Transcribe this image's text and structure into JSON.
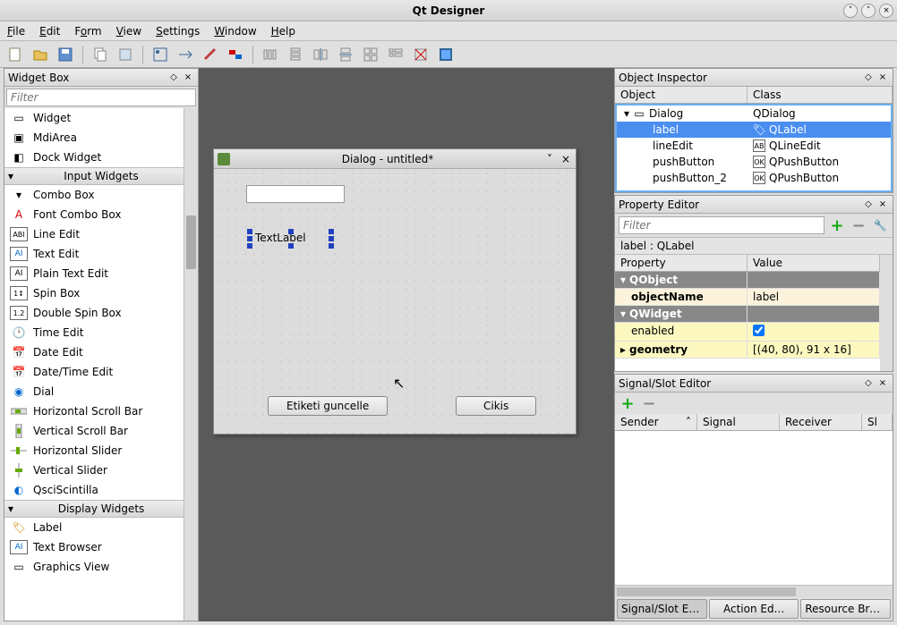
{
  "window": {
    "title": "Qt Designer"
  },
  "menu": {
    "file": "File",
    "edit": "Edit",
    "form": "Form",
    "view": "View",
    "settings": "Settings",
    "window": "Window",
    "help": "Help"
  },
  "widgetbox": {
    "title": "Widget Box",
    "filter_placeholder": "Filter",
    "items": [
      {
        "label": "Widget"
      },
      {
        "label": "MdiArea"
      },
      {
        "label": "Dock Widget"
      }
    ],
    "cat_input": "Input Widgets",
    "input_widgets": [
      {
        "label": "Combo Box"
      },
      {
        "label": "Font Combo Box"
      },
      {
        "label": "Line Edit"
      },
      {
        "label": "Text Edit"
      },
      {
        "label": "Plain Text Edit"
      },
      {
        "label": "Spin Box"
      },
      {
        "label": "Double Spin Box"
      },
      {
        "label": "Time Edit"
      },
      {
        "label": "Date Edit"
      },
      {
        "label": "Date/Time Edit"
      },
      {
        "label": "Dial"
      },
      {
        "label": "Horizontal Scroll Bar"
      },
      {
        "label": "Vertical Scroll Bar"
      },
      {
        "label": "Horizontal Slider"
      },
      {
        "label": "Vertical Slider"
      },
      {
        "label": "QsciScintilla"
      }
    ],
    "cat_display": "Display Widgets",
    "display_widgets": [
      {
        "label": "Label"
      },
      {
        "label": "Text Browser"
      },
      {
        "label": "Graphics View"
      }
    ]
  },
  "dialog": {
    "title": "Dialog - untitled*",
    "label_text": "TextLabel",
    "btn1": "Etiketi guncelle",
    "btn2": "Cikis"
  },
  "object_inspector": {
    "title": "Object Inspector",
    "col_object": "Object",
    "col_class": "Class",
    "rows": [
      {
        "object": "Dialog",
        "class": "QDialog",
        "indent": 0
      },
      {
        "object": "label",
        "class": "QLabel",
        "indent": 1,
        "selected": true
      },
      {
        "object": "lineEdit",
        "class": "QLineEdit",
        "indent": 1
      },
      {
        "object": "pushButton",
        "class": "QPushButton",
        "indent": 1
      },
      {
        "object": "pushButton_2",
        "class": "QPushButton",
        "indent": 1
      }
    ]
  },
  "property_editor": {
    "title": "Property Editor",
    "filter_placeholder": "Filter",
    "object_label": "label : QLabel",
    "col_property": "Property",
    "col_value": "Value",
    "group_qobject": "QObject",
    "prop_objectname": "objectName",
    "val_objectname": "label",
    "group_qwidget": "QWidget",
    "prop_enabled": "enabled",
    "prop_geometry": "geometry",
    "val_geometry": "[(40, 80), 91 x 16]"
  },
  "signal_editor": {
    "title": "Signal/Slot Editor",
    "col_sender": "Sender",
    "col_signal": "Signal",
    "col_receiver": "Receiver",
    "col_slot": "Sl"
  },
  "bottom_tabs": {
    "signal": "Signal/Slot Edi...",
    "action": "Action Ed...",
    "resource": "Resource Brow..."
  }
}
